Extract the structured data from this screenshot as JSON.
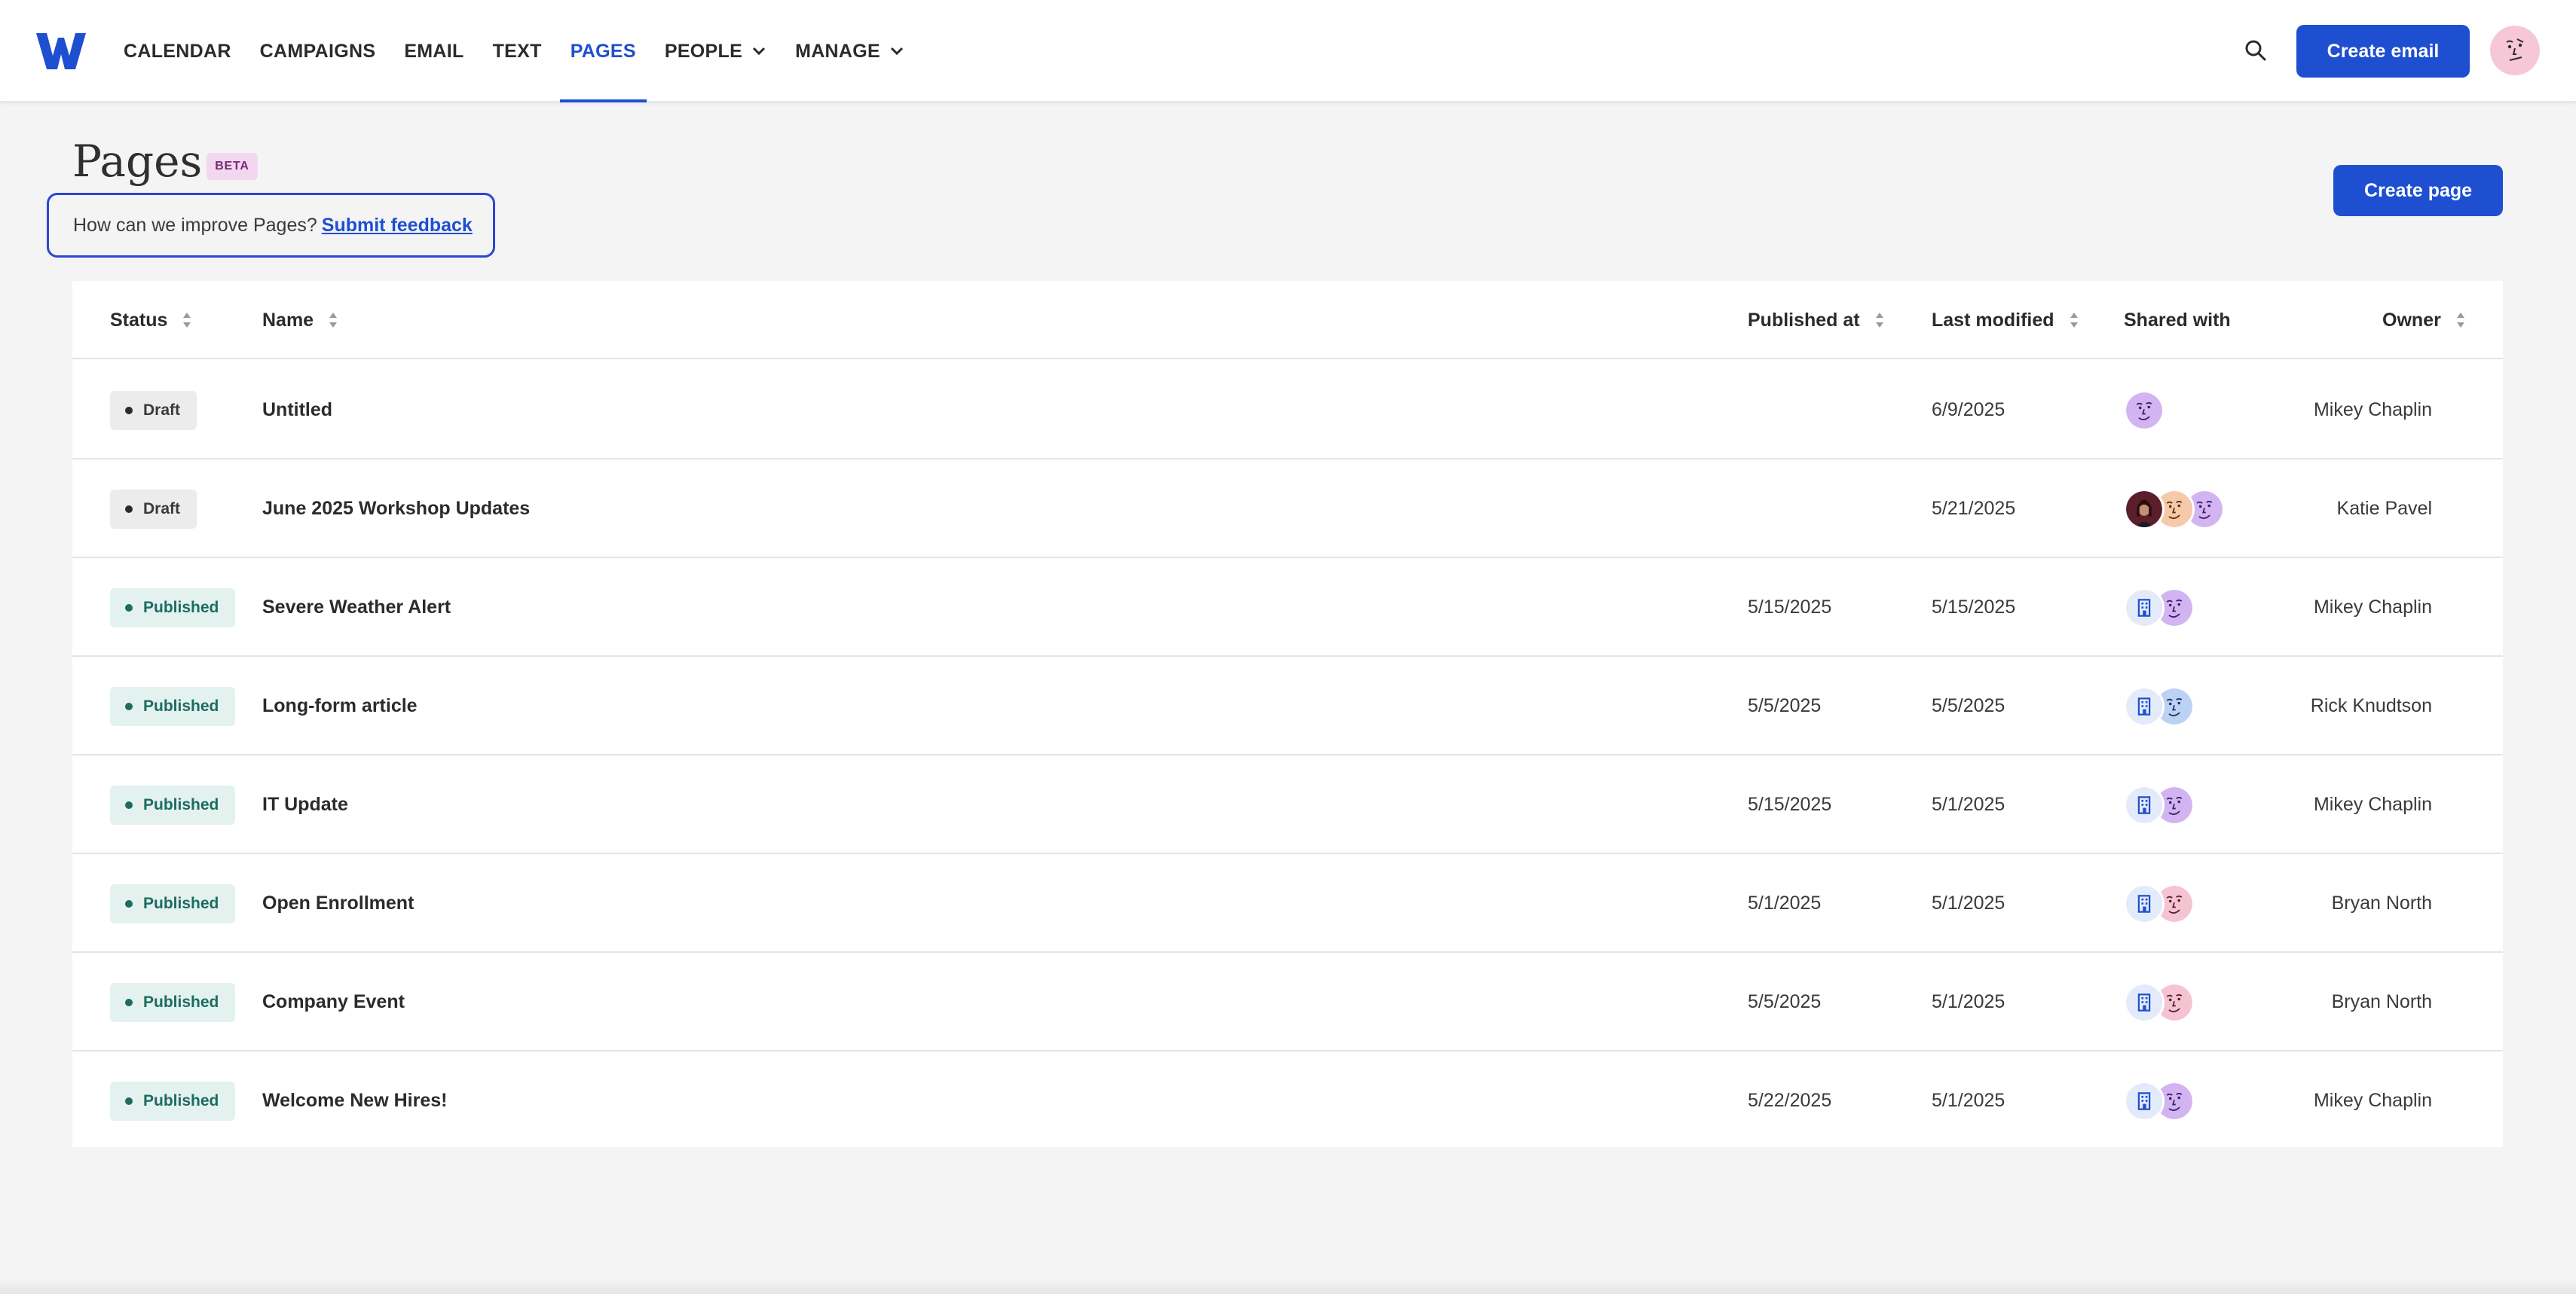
{
  "nav": {
    "items": [
      {
        "label": "CALENDAR",
        "active": false,
        "dropdown": false
      },
      {
        "label": "CAMPAIGNS",
        "active": false,
        "dropdown": false
      },
      {
        "label": "EMAIL",
        "active": false,
        "dropdown": false
      },
      {
        "label": "TEXT",
        "active": false,
        "dropdown": false
      },
      {
        "label": "PAGES",
        "active": true,
        "dropdown": false
      },
      {
        "label": "PEOPLE",
        "active": false,
        "dropdown": true
      },
      {
        "label": "MANAGE",
        "active": false,
        "dropdown": true
      }
    ],
    "create_email_label": "Create email",
    "accent_color": "#1f4fd1"
  },
  "header": {
    "title": "Pages",
    "badge": "BETA",
    "feedback_prompt": "How can we improve Pages?",
    "feedback_link": "Submit feedback",
    "create_page_label": "Create page"
  },
  "table": {
    "columns": {
      "status": "Status",
      "name": "Name",
      "published_at": "Published at",
      "last_modified": "Last modified",
      "shared_with": "Shared with",
      "owner": "Owner"
    },
    "rows": [
      {
        "status": "Draft",
        "name": "Untitled",
        "published_at": "",
        "last_modified": "6/9/2025",
        "shared_with": [
          "purple-face"
        ],
        "owner": "Mikey Chaplin"
      },
      {
        "status": "Draft",
        "name": "June 2025 Workshop Updates",
        "published_at": "",
        "last_modified": "5/21/2025",
        "shared_with": [
          "photo-woman",
          "orange-face",
          "purple-face"
        ],
        "owner": "Katie Pavel"
      },
      {
        "status": "Published",
        "name": "Severe Weather Alert",
        "published_at": "5/15/2025",
        "last_modified": "5/15/2025",
        "shared_with": [
          "building-icon",
          "purple-face"
        ],
        "owner": "Mikey Chaplin"
      },
      {
        "status": "Published",
        "name": "Long-form article",
        "published_at": "5/5/2025",
        "last_modified": "5/5/2025",
        "shared_with": [
          "building-icon",
          "blue-face"
        ],
        "owner": "Rick Knudtson"
      },
      {
        "status": "Published",
        "name": "IT Update",
        "published_at": "5/15/2025",
        "last_modified": "5/1/2025",
        "shared_with": [
          "building-icon",
          "purple-face"
        ],
        "owner": "Mikey Chaplin"
      },
      {
        "status": "Published",
        "name": "Open Enrollment",
        "published_at": "5/1/2025",
        "last_modified": "5/1/2025",
        "shared_with": [
          "building-icon",
          "pink-face"
        ],
        "owner": "Bryan North"
      },
      {
        "status": "Published",
        "name": "Company Event",
        "published_at": "5/5/2025",
        "last_modified": "5/1/2025",
        "shared_with": [
          "building-icon",
          "pink-face"
        ],
        "owner": "Bryan North"
      },
      {
        "status": "Published",
        "name": "Welcome New Hires!",
        "published_at": "5/22/2025",
        "last_modified": "5/1/2025",
        "shared_with": [
          "building-icon",
          "purple-face"
        ],
        "owner": "Mikey Chaplin"
      }
    ]
  }
}
